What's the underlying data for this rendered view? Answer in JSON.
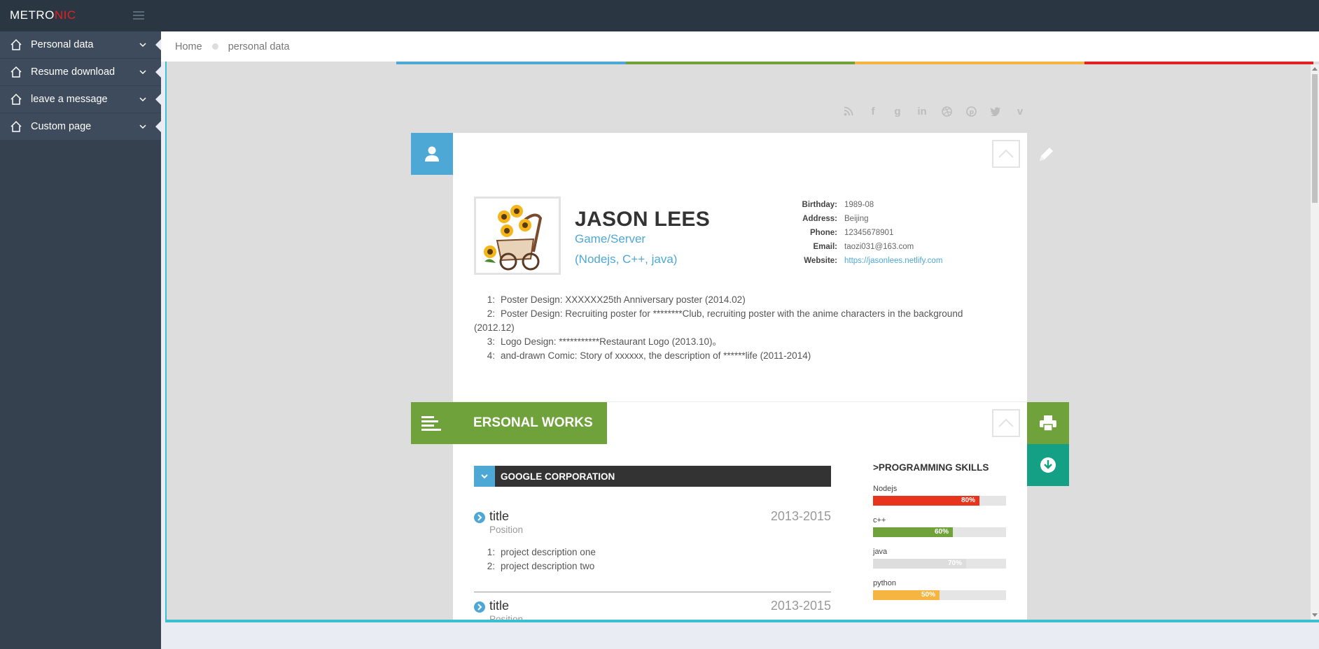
{
  "topbar": {
    "logo_main": "METRO",
    "logo_accent": "NIC"
  },
  "sidebar": {
    "items": [
      {
        "label": "Personal data"
      },
      {
        "label": "Resume download"
      },
      {
        "label": "leave a message"
      },
      {
        "label": "Custom page"
      }
    ]
  },
  "breadcrumb": {
    "home": "Home",
    "current": "personal data"
  },
  "colors": {
    "accent_blue": "#4ea8d6",
    "accent_green": "#6fa23b",
    "accent_teal": "#13a085",
    "colorbar": [
      "#4ea8d6",
      "#6fa23b",
      "#f5b540",
      "#e02222"
    ]
  },
  "social_icons": [
    "rss-icon",
    "facebook-icon",
    "google-plus-icon",
    "linkedin-icon",
    "dribbble-icon",
    "pinterest-icon",
    "twitter-icon",
    "vimeo-icon"
  ],
  "profile": {
    "name": "JASON LEES",
    "role": "Game/Server",
    "stack": "(Nodejs, C++, java)",
    "info": [
      {
        "key": "Birthday:",
        "value": "1989-08"
      },
      {
        "key": "Address:",
        "value": "Beijing"
      },
      {
        "key": "Phone:",
        "value": "12345678901"
      },
      {
        "key": "Email:",
        "value": "taozi031@163.com"
      },
      {
        "key": "Website:",
        "value": "https://jasonlees.netlify.com"
      }
    ],
    "achievements": [
      {
        "num": "1:",
        "text": "Poster Design: XXXXXX25th Anniversary poster (2014.02)"
      },
      {
        "num": "2:",
        "text": "Poster Design: Recruiting poster for ********Club, recruiting poster with the anime characters in the background (2012.12)"
      },
      {
        "num": "3:",
        "text": "Logo Design: ***********Restaurant Logo (2013.10)。"
      },
      {
        "num": "4:",
        "text": "and-drawn Comic: Story of xxxxxx, the description of ******life (2011-2014)"
      }
    ]
  },
  "works": {
    "heading": "ERSONAL WORKS",
    "company": "GOOGLE CORPORATION",
    "jobs": [
      {
        "title": "title",
        "years": "2013-2015",
        "position": "Position",
        "descriptions": [
          {
            "num": "1:",
            "text": "project description one"
          },
          {
            "num": "2:",
            "text": "project description two"
          }
        ]
      },
      {
        "title": "title",
        "years": "2013-2015",
        "position": "Position"
      }
    ]
  },
  "skills": {
    "heading": ">PROGRAMMING SKILLS",
    "items": [
      {
        "name": "Nodejs",
        "percent": 80,
        "label": "80%",
        "color": "#e8341c"
      },
      {
        "name": "c++",
        "percent": 60,
        "label": "60%",
        "color": "#6fa23b"
      },
      {
        "name": "java",
        "percent": 70,
        "label": "70%",
        "color": "#dddddd"
      },
      {
        "name": "python",
        "percent": 50,
        "label": "50%",
        "color": "#f5b540"
      }
    ]
  }
}
